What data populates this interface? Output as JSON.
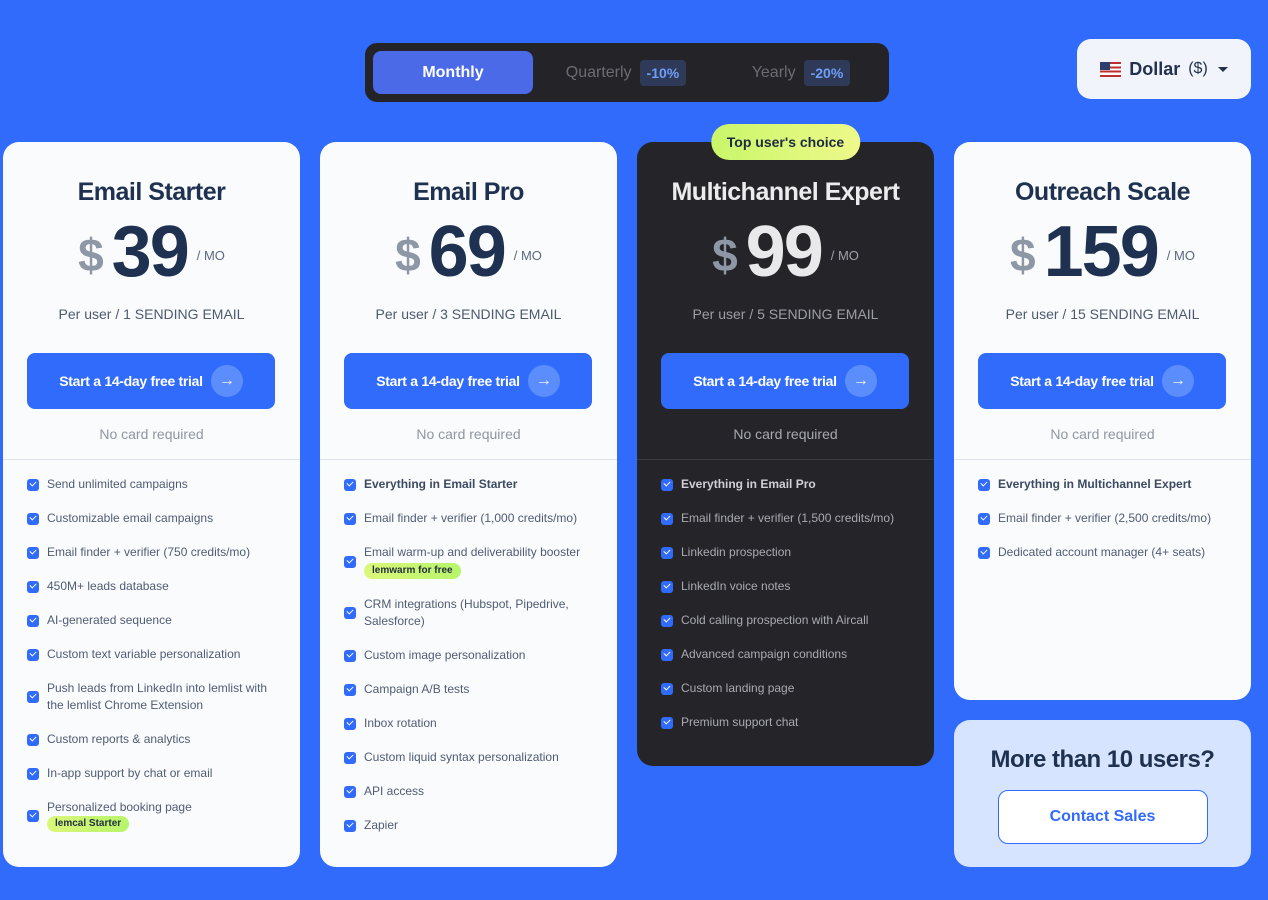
{
  "billing": {
    "options": [
      {
        "label": "Monthly",
        "active": true
      },
      {
        "label": "Quarterly",
        "discount": "-10%"
      },
      {
        "label": "Yearly",
        "discount": "-20%"
      }
    ]
  },
  "currency": {
    "flag": "us-flag-icon",
    "name": "Dollar",
    "symbol": "($)"
  },
  "common": {
    "cta_label": "Start a 14-day free trial",
    "no_card": "No card required",
    "per_mo": "/ MO",
    "currency_symbol": "$"
  },
  "plans": [
    {
      "name": "Email Starter",
      "price": "39",
      "per_user": "Per user / 1 SENDING EMAIL",
      "features": [
        {
          "text": "Send unlimited campaigns"
        },
        {
          "text": "Customizable email campaigns"
        },
        {
          "text": "Email finder + verifier (750 credits/mo)"
        },
        {
          "text": "450M+ leads database"
        },
        {
          "text": "AI-generated sequence"
        },
        {
          "text": "Custom text variable personalization"
        },
        {
          "text": "Push leads from LinkedIn into lemlist with the lemlist Chrome Extension"
        },
        {
          "text": "Custom reports & analytics"
        },
        {
          "text": "In-app support by chat or email"
        },
        {
          "text": "Personalized booking page",
          "pill": "lemcal Starter"
        }
      ]
    },
    {
      "name": "Email Pro",
      "price": "69",
      "per_user": "Per user / 3 SENDING EMAIL",
      "features": [
        {
          "text": "Everything in Email Starter",
          "bold": true
        },
        {
          "text": "Email finder + verifier (1,000 credits/mo)"
        },
        {
          "text": "Email warm-up and deliverability booster",
          "pill": "lemwarm for free"
        },
        {
          "text": "CRM integrations (Hubspot, Pipedrive, Salesforce)"
        },
        {
          "text": "Custom image personalization"
        },
        {
          "text": "Campaign A/B tests"
        },
        {
          "text": "Inbox rotation"
        },
        {
          "text": "Custom liquid syntax personalization"
        },
        {
          "text": "API access"
        },
        {
          "text": "Zapier"
        }
      ]
    },
    {
      "name": "Multichannel Expert",
      "price": "99",
      "per_user": "Per user / 5 SENDING EMAIL",
      "badge": "Top user's choice",
      "features": [
        {
          "text": "Everything in Email Pro",
          "bold": true
        },
        {
          "text": "Email finder + verifier (1,500 credits/mo)"
        },
        {
          "text": "Linkedin prospection"
        },
        {
          "text": "LinkedIn voice notes"
        },
        {
          "text": "Cold calling prospection with Aircall"
        },
        {
          "text": "Advanced campaign conditions"
        },
        {
          "text": "Custom landing page"
        },
        {
          "text": "Premium support chat"
        }
      ]
    },
    {
      "name": "Outreach Scale",
      "price": "159",
      "per_user": "Per user / 15 SENDING EMAIL",
      "features": [
        {
          "text": "Everything in Multichannel Expert",
          "bold": true
        },
        {
          "text": "Email finder + verifier (2,500 credits/mo)"
        },
        {
          "text": "Dedicated account manager (4+ seats)"
        }
      ]
    }
  ],
  "more_users": {
    "title": "More than 10 users?",
    "button": "Contact Sales"
  },
  "colors": {
    "background": "#316bfb",
    "accent": "#316bfb",
    "dark_card": "#252529",
    "pill": "#c9f66a"
  }
}
